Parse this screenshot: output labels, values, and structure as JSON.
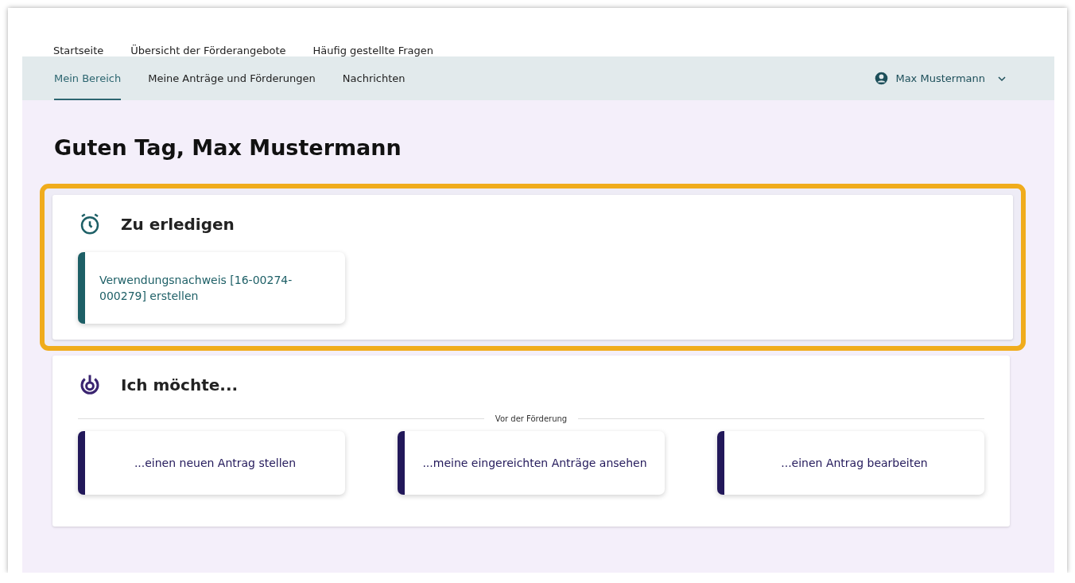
{
  "top_nav": [
    {
      "label": "Startseite"
    },
    {
      "label": "Übersicht der Förderangebote"
    },
    {
      "label": "Häufig gestellte Fragen"
    }
  ],
  "tabs": [
    {
      "label": "Mein Bereich",
      "selected": true
    },
    {
      "label": "Meine Anträge und Förderungen",
      "selected": false
    },
    {
      "label": "Nachrichten",
      "selected": false
    }
  ],
  "user_menu": {
    "name": "Max Mustermann"
  },
  "greeting": "Guten Tag, Max Mustermann",
  "todo": {
    "title": "Zu erledigen",
    "highlighted": true,
    "items": [
      {
        "label": "Verwendungsnachweis [16-00274-000279] erstellen"
      }
    ]
  },
  "wishes": {
    "title": "Ich möchte...",
    "divider_label": "Vor der Förderung",
    "actions": [
      {
        "label": "...einen neuen Antrag stellen"
      },
      {
        "label": "...meine eingereichten Anträge ansehen"
      },
      {
        "label": "...einen Antrag bearbeiten"
      }
    ]
  }
}
